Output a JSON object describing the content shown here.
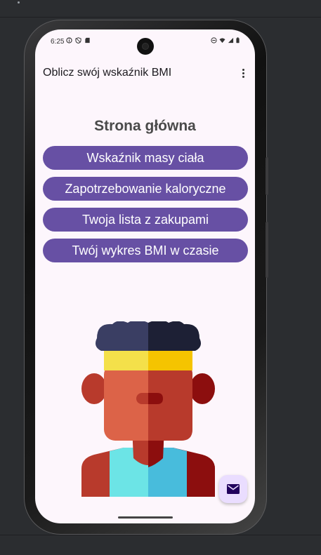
{
  "status_bar": {
    "time": "6:25",
    "icons_left": [
      "info-icon",
      "shield-icon",
      "sd-card-icon"
    ],
    "icons_right": [
      "do-not-disturb-icon",
      "wifi-icon",
      "signal-icon",
      "battery-icon"
    ]
  },
  "app_bar": {
    "title": "Oblicz swój wskaźnik BMI",
    "overflow_icon": "more-vert-icon"
  },
  "main": {
    "heading": "Strona główna",
    "buttons": [
      {
        "label": "Wskaźnik masy ciała"
      },
      {
        "label": "Zapotrzebowanie kaloryczne"
      },
      {
        "label": "Twoja lista z zakupami"
      },
      {
        "label": "Twój wykres BMI w czasie"
      }
    ],
    "illustration": "person-avatar-illustration"
  },
  "fab": {
    "icon": "mail-icon"
  },
  "colors": {
    "primary": "#6750a4",
    "background": "#fdf6fc",
    "fab_container": "#eaddff",
    "fab_icon": "#21005d"
  }
}
